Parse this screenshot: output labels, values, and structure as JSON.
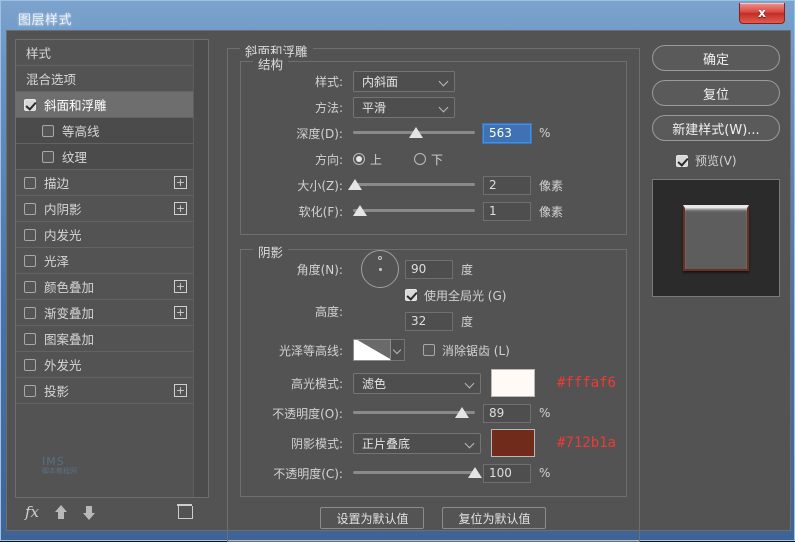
{
  "window": {
    "title": "图层样式",
    "close_label": "x"
  },
  "sidebar": {
    "items": [
      {
        "label": "样式",
        "checkbox": false,
        "checked": false,
        "sub": false,
        "selected": false,
        "plus": false
      },
      {
        "label": "混合选项",
        "checkbox": false,
        "checked": false,
        "sub": false,
        "selected": false,
        "plus": false
      },
      {
        "label": "斜面和浮雕",
        "checkbox": true,
        "checked": true,
        "sub": false,
        "selected": true,
        "plus": false
      },
      {
        "label": "等高线",
        "checkbox": true,
        "checked": false,
        "sub": true,
        "selected": false,
        "plus": false
      },
      {
        "label": "纹理",
        "checkbox": true,
        "checked": false,
        "sub": true,
        "selected": false,
        "plus": false
      },
      {
        "label": "描边",
        "checkbox": true,
        "checked": false,
        "sub": false,
        "selected": false,
        "plus": true
      },
      {
        "label": "内阴影",
        "checkbox": true,
        "checked": false,
        "sub": false,
        "selected": false,
        "plus": true
      },
      {
        "label": "内发光",
        "checkbox": true,
        "checked": false,
        "sub": false,
        "selected": false,
        "plus": false
      },
      {
        "label": "光泽",
        "checkbox": true,
        "checked": false,
        "sub": false,
        "selected": false,
        "plus": false
      },
      {
        "label": "颜色叠加",
        "checkbox": true,
        "checked": false,
        "sub": false,
        "selected": false,
        "plus": true
      },
      {
        "label": "渐变叠加",
        "checkbox": true,
        "checked": false,
        "sub": false,
        "selected": false,
        "plus": true
      },
      {
        "label": "图案叠加",
        "checkbox": true,
        "checked": false,
        "sub": false,
        "selected": false,
        "plus": false
      },
      {
        "label": "外发光",
        "checkbox": true,
        "checked": false,
        "sub": false,
        "selected": false,
        "plus": false
      },
      {
        "label": "投影",
        "checkbox": true,
        "checked": false,
        "sub": false,
        "selected": false,
        "plus": true
      }
    ],
    "watermark_line1": "IMS",
    "watermark_line2": "脚本教程网",
    "toolbar": {
      "fx_label": "fx",
      "move_up": "move-up",
      "move_down": "move-down",
      "delete": "delete"
    }
  },
  "main": {
    "section_title": "斜面和浮雕",
    "structure": {
      "legend": "结构",
      "style_label": "样式:",
      "style_value": "内斜面",
      "method_label": "方法:",
      "method_value": "平滑",
      "depth_label": "深度(D):",
      "depth_value": "563",
      "depth_unit": "%",
      "depth_slider_pct": 52,
      "direction_label": "方向:",
      "direction_up": "上",
      "direction_down": "下",
      "direction_selected": "上",
      "size_label": "大小(Z):",
      "size_value": "2",
      "size_unit": "像素",
      "size_slider_pct": 2,
      "soften_label": "软化(F):",
      "soften_value": "1",
      "soften_unit": "像素",
      "soften_slider_pct": 6
    },
    "shading": {
      "legend": "阴影",
      "angle_label": "角度(N):",
      "angle_value": "90",
      "angle_unit": "度",
      "global_light_label": "使用全局光 (G)",
      "global_light_checked": true,
      "altitude_label": "高度:",
      "altitude_value": "32",
      "altitude_unit": "度",
      "gloss_contour_label": "光泽等高线:",
      "antialias_label": "消除锯齿 (L)",
      "antialias_checked": false,
      "highlight_mode_label": "高光模式:",
      "highlight_mode_value": "滤色",
      "highlight_color": "#fffaf6",
      "highlight_hex_note": "#fffaf6",
      "highlight_opacity_label": "不透明度(O):",
      "highlight_opacity_value": "89",
      "highlight_opacity_unit": "%",
      "highlight_opacity_pct": 89,
      "shadow_mode_label": "阴影模式:",
      "shadow_mode_value": "正片叠底",
      "shadow_color": "#712b1a",
      "shadow_hex_note": "#712b1a",
      "shadow_opacity_label": "不透明度(C):",
      "shadow_opacity_value": "100",
      "shadow_opacity_unit": "%",
      "shadow_opacity_pct": 100
    },
    "footer": {
      "set_default": "设置为默认值",
      "reset_default": "复位为默认值"
    }
  },
  "right": {
    "ok": "确定",
    "reset": "复位",
    "new_style": "新建样式(W)...",
    "preview_label": "预览(V)",
    "preview_checked": true
  }
}
